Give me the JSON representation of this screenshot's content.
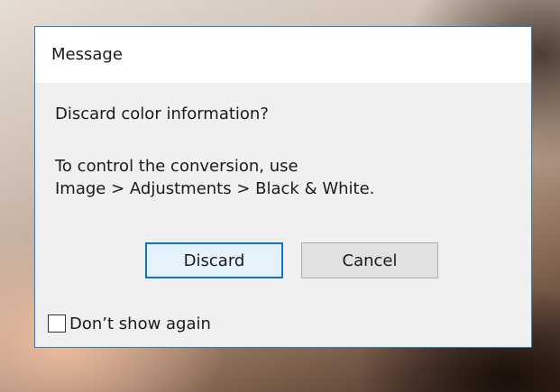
{
  "dialog": {
    "title": "Message",
    "heading": "Discard color information?",
    "body_lines": [
      "To control the conversion, use",
      "Image > Adjustments > Black & White."
    ],
    "buttons": {
      "discard_label": "Discard",
      "cancel_label": "Cancel"
    },
    "checkbox": {
      "label": "Don’t show again",
      "checked": false
    }
  },
  "colors": {
    "accent_border": "#0a74d6",
    "dialog_border": "#2b7bd4",
    "dialog_bg": "#f0f0f0"
  }
}
